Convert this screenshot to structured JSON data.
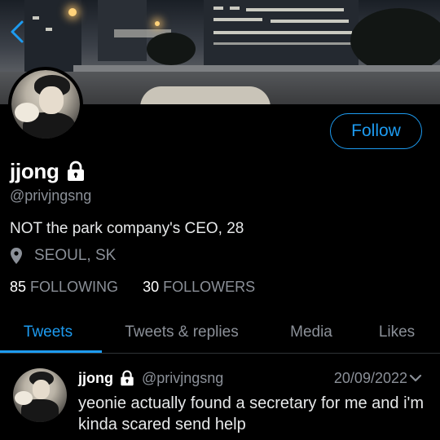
{
  "nav": {
    "back_icon": "chevron-left-icon"
  },
  "profile": {
    "name": "jjong",
    "locked_icon": "lock-icon",
    "handle": "@privjngsng",
    "bio": "NOT the park company's CEO, 28",
    "location_icon": "map-pin-icon",
    "location": "SEOUL, SK",
    "following_count": "85",
    "following_label": "FOLLOWING",
    "followers_count": "30",
    "followers_label": "FOLLOWERS",
    "follow_label": "Follow"
  },
  "tabs": [
    {
      "label": "Tweets",
      "active": true
    },
    {
      "label": "Tweets & replies",
      "active": false
    },
    {
      "label": "Media",
      "active": false
    },
    {
      "label": "Likes",
      "active": false
    }
  ],
  "tweets": [
    {
      "name": "jjong",
      "handle": "@privjngsng",
      "date": "20/09/2022",
      "text": "yeonie actually found a secretary for me and i'm kinda scared send help",
      "menu_icon": "chevron-down-icon"
    }
  ],
  "colors": {
    "accent": "#1d9bf0",
    "background": "#000000",
    "muted": "#8b9098"
  }
}
